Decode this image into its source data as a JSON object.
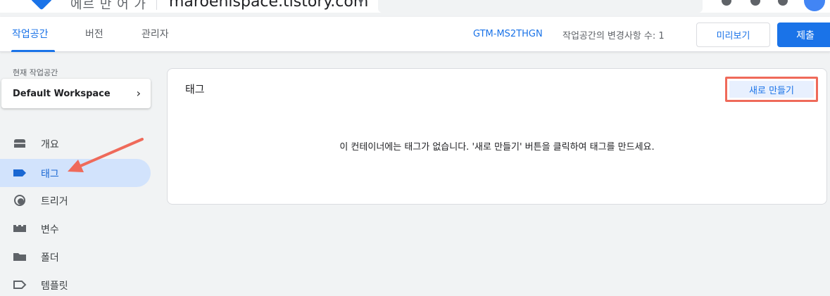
{
  "topbar": {
    "account_name": "에르 만 어 가",
    "container_name": "maroenispace.tistory.com"
  },
  "tabs": [
    {
      "label": "작업공간",
      "active": true
    },
    {
      "label": "버전",
      "active": false
    },
    {
      "label": "관리자",
      "active": false
    }
  ],
  "header": {
    "container_id": "GTM-MS2THGN",
    "changes_text": "작업공간의 변경사항 수: 1",
    "preview_label": "미리보기",
    "submit_label": "제출"
  },
  "sidebar": {
    "workspace_label": "현재 작업공간",
    "workspace_name": "Default Workspace",
    "items": [
      {
        "label": "개요",
        "icon": "overview-icon"
      },
      {
        "label": "태그",
        "icon": "tag-icon",
        "active": true
      },
      {
        "label": "트리거",
        "icon": "trigger-icon"
      },
      {
        "label": "변수",
        "icon": "variable-icon"
      },
      {
        "label": "폴더",
        "icon": "folder-icon"
      },
      {
        "label": "템플릿",
        "icon": "template-icon"
      }
    ]
  },
  "main": {
    "title": "태그",
    "new_button_label": "새로 만들기",
    "empty_message": "이 컨테이너에는 태그가 없습니다. '새로 만들기' 버튼을 클릭하여 태그를 만드세요."
  },
  "colors": {
    "accent": "#1a73e8",
    "active_nav_bg": "#d2e3fc",
    "annotation": "#ef6a5a"
  }
}
